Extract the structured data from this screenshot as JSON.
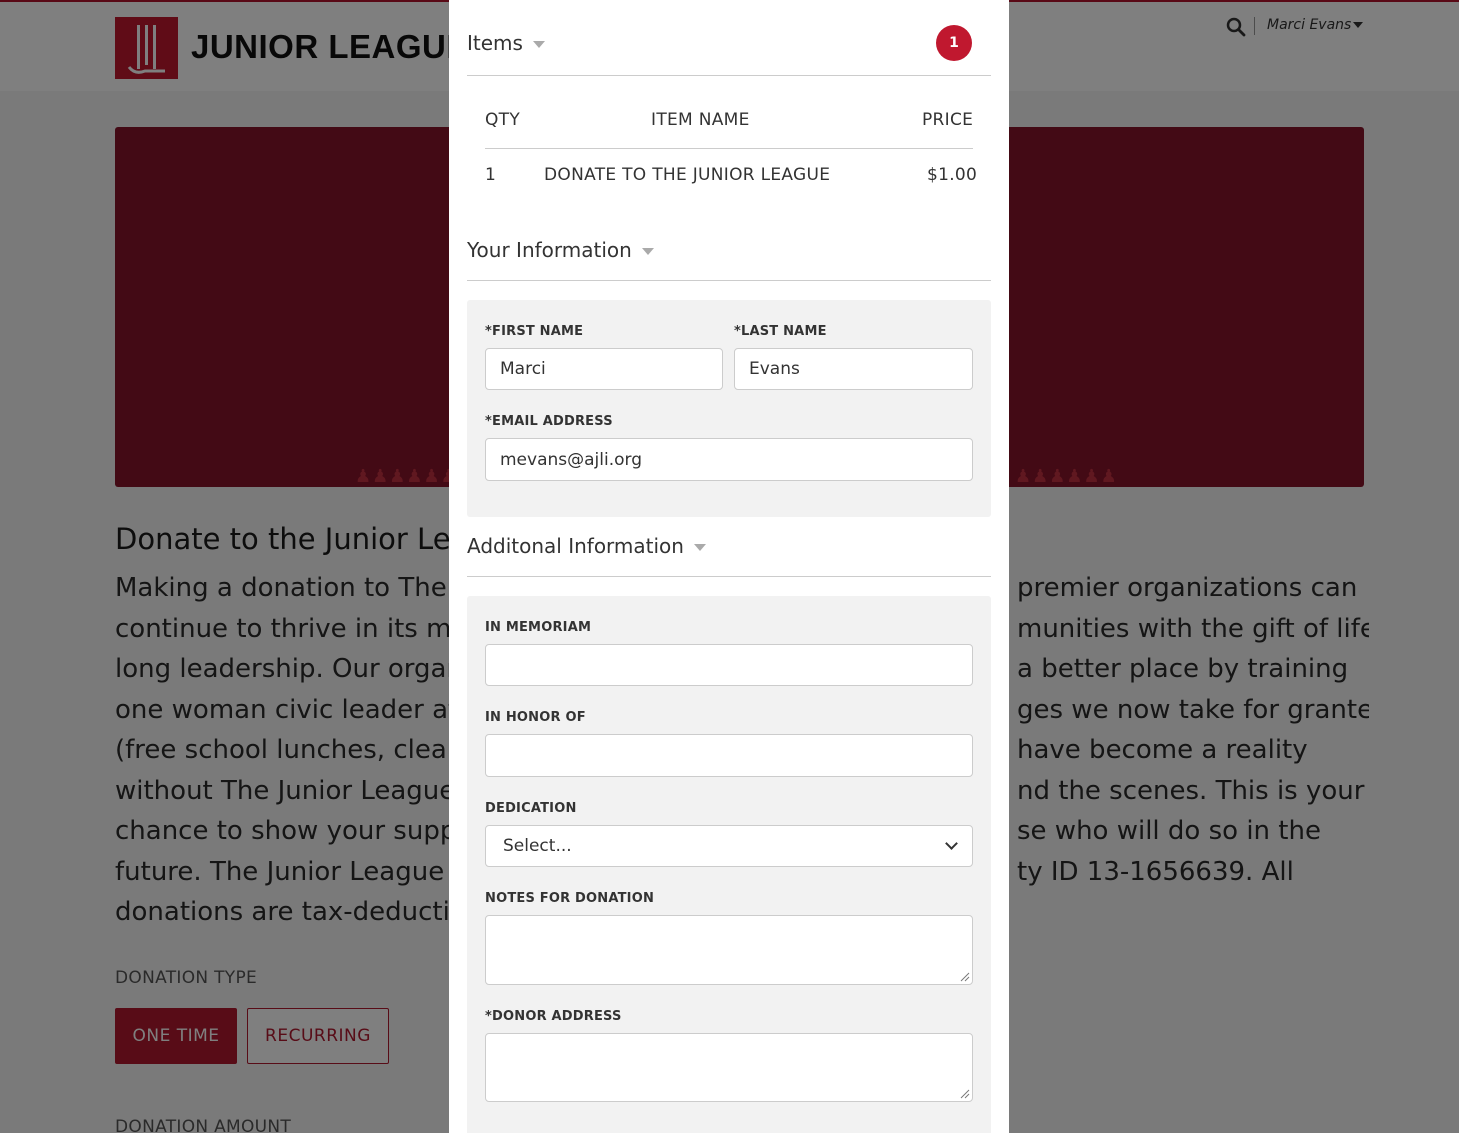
{
  "header": {
    "logo_text": "JUNIOR LEAGUE",
    "user_name": "Marci Evans"
  },
  "page": {
    "title": "Donate to the Junior Le",
    "body_lines": [
      [
        "Making a donation to The J",
        "premier organizations can"
      ],
      [
        "continue to thrive in its mis",
        "munities with the gift of life-"
      ],
      [
        "long leadership. Our organi",
        "a better place by training"
      ],
      [
        "one woman civic leader at a",
        "ges we now take for granted,"
      ],
      [
        "(free school lunches, clean",
        "have become a reality"
      ],
      [
        "without The Junior League,",
        "nd the scenes. This is your"
      ],
      [
        "chance to show your suppo",
        "se who will do so in the"
      ],
      [
        "future. The Junior League is",
        "ty ID 13-1656639. All"
      ],
      [
        "donations are tax-deductib",
        ""
      ]
    ],
    "donation_type_label": "DONATION TYPE",
    "donation_type_options": [
      "ONE TIME",
      "RECURRING"
    ],
    "donation_amount_label": "DONATION AMOUNT"
  },
  "modal": {
    "items": {
      "title": "Items",
      "count": "1",
      "columns": [
        "QTY",
        "ITEM NAME",
        "PRICE"
      ],
      "rows": [
        {
          "qty": "1",
          "name": "DONATE TO THE JUNIOR LEAGUE",
          "price": "$1.00"
        }
      ]
    },
    "your_info": {
      "title": "Your Information",
      "first_name_label": "*FIRST NAME",
      "first_name_value": "Marci",
      "last_name_label": "*LAST NAME",
      "last_name_value": "Evans",
      "email_label": "*EMAIL ADDRESS",
      "email_value": "mevans@ajli.org"
    },
    "additional": {
      "title": "Additonal Information",
      "in_memoriam_label": "IN MEMORIAM",
      "in_memoriam_value": "",
      "in_honor_label": "IN HONOR OF",
      "in_honor_value": "",
      "dedication_label": "DEDICATION",
      "dedication_value": "Select...",
      "notes_label": "NOTES FOR DONATION",
      "donor_address_label": "*DONOR ADDRESS"
    }
  },
  "colors": {
    "brand_red": "#c0182f",
    "hero_red": "#86142a"
  }
}
